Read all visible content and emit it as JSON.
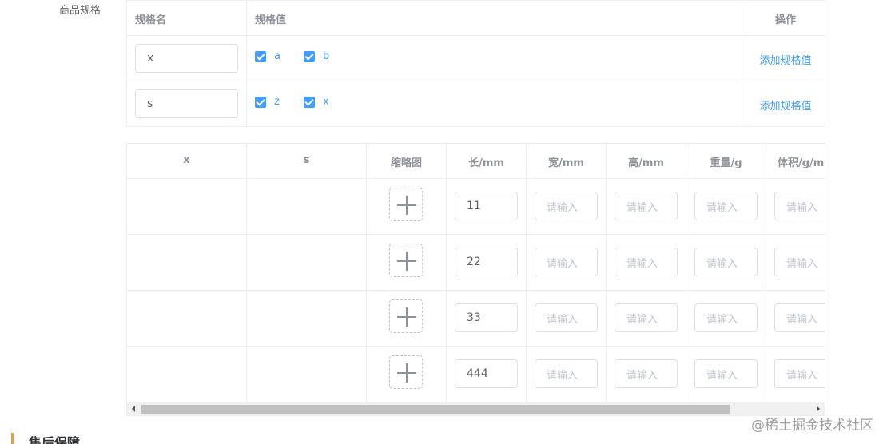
{
  "field_label": "商品规格",
  "spec_table": {
    "headers": {
      "name": "规格名",
      "values": "规格值",
      "ops": "操作"
    },
    "rows": [
      {
        "name": "x",
        "values": [
          "a",
          "b"
        ],
        "action": "添加规格值"
      },
      {
        "name": "s",
        "values": [
          "z",
          "x"
        ],
        "action": "添加规格值"
      }
    ]
  },
  "sku_table": {
    "headers": {
      "x": "x",
      "s": "s",
      "thumb": "缩略图",
      "length": "长/mm",
      "width": "宽/mm",
      "height": "高/mm",
      "weight": "重量/g",
      "volume": "体积/g/mm"
    },
    "placeholder": "请输入",
    "rows": [
      {
        "length": "11"
      },
      {
        "length": "22"
      },
      {
        "length": "33"
      },
      {
        "length": "444"
      }
    ]
  },
  "section_title": "售后保障",
  "watermark": "@稀土掘金技术社区",
  "colors": {
    "accent": "#409eff",
    "section_bar": "#e6a23c"
  }
}
